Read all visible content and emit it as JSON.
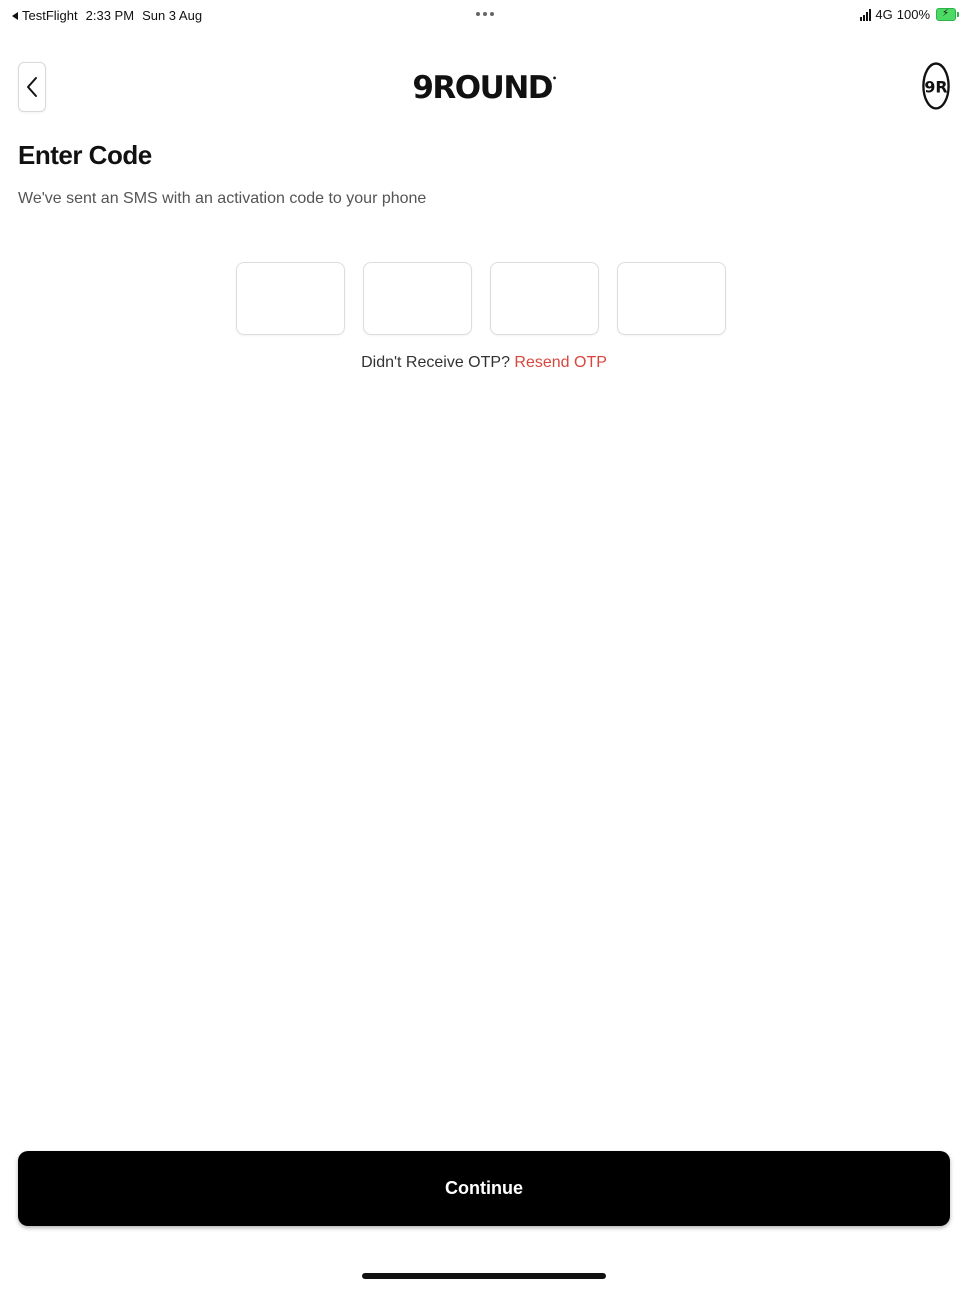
{
  "status_bar": {
    "back_app": "TestFlight",
    "time": "2:33 PM",
    "date": "Sun 3 Aug",
    "network": "4G",
    "battery": "100%"
  },
  "header": {
    "logo_text": "9ROUND",
    "avatar_text": "9R"
  },
  "page": {
    "title": "Enter Code",
    "subtitle": "We've sent an SMS with an activation code to your phone"
  },
  "otp": {
    "digits": [
      "",
      "",
      "",
      ""
    ],
    "prompt": "Didn't Receive OTP?",
    "resend_label": "Resend OTP"
  },
  "actions": {
    "continue_label": "Continue"
  },
  "colors": {
    "accent": "#d9463e",
    "primary_button": "#000000"
  }
}
